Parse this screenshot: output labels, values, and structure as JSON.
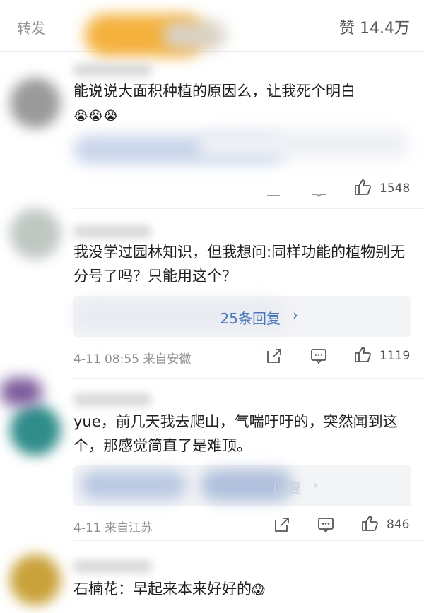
{
  "header": {
    "repost_tab": "转发",
    "likes_label": "赞 14.4万"
  },
  "comments": [
    {
      "text": "能说说大面积种植的原因么，让我死个明白",
      "emoji": "😭😭😭",
      "likes": "1548"
    },
    {
      "text": "我没学过园林知识，但我想问:同样功能的植物别无分号了吗？只能用这个？",
      "reply_label": "25条回复",
      "reply_chevron": "›",
      "meta": "4-11 08:55  来自安徽",
      "likes": "1119"
    },
    {
      "text": "yue，前几天我去爬山，气喘吁吁的，突然闻到这个，那感觉简直了是难顶。",
      "reply_label": "回复",
      "reply_chevron": "›",
      "meta": "4-11  来自江苏",
      "likes": "846"
    },
    {
      "text": "石楠花：早起来本来好好的",
      "emoji": "😱"
    }
  ],
  "colors": {
    "link": "#4a78b8",
    "meta": "#8f8f8f"
  }
}
